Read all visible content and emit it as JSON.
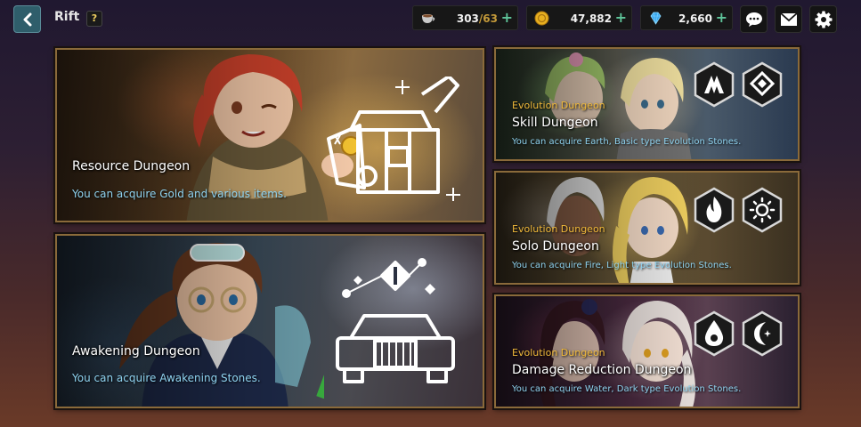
{
  "header": {
    "title": "Rift",
    "help_label": "?",
    "back_icon": "chevron-left-icon"
  },
  "resources": [
    {
      "icon": "coffee-cup-icon",
      "current": "303",
      "cap": "/63",
      "color": "#c49a3a"
    },
    {
      "icon": "gold-coin-icon",
      "value": "47,882",
      "color": "#e8b020"
    },
    {
      "icon": "diamond-icon",
      "value": "2,660",
      "color": "#3aa8f0"
    }
  ],
  "top_buttons": [
    "chat-icon",
    "mail-icon",
    "gear-icon"
  ],
  "dungeons": {
    "resource": {
      "name": "Resource Dungeon",
      "description": "You can acquire Gold and various items.",
      "icon": "treasure-chest-icon"
    },
    "awakening": {
      "name": "Awakening Dungeon",
      "description": "You can acquire Awakening Stones.",
      "icon": "vehicle-icon"
    },
    "skill": {
      "category": "Evolution Dungeon",
      "name": "Skill Dungeon",
      "description": "You can acquire Earth, Basic type Evolution Stones.",
      "elements": [
        "earth-element-icon",
        "basic-element-icon"
      ]
    },
    "solo": {
      "category": "Evolution Dungeon",
      "name": "Solo Dungeon",
      "description": "You can acquire Fire, Light type Evolution Stones.",
      "elements": [
        "fire-element-icon",
        "light-element-icon"
      ]
    },
    "damage_reduction": {
      "category": "Evolution Dungeon",
      "name": "Damage Reduction Dungeon",
      "description": "You can acquire Water, Dark type Evolution Stones.",
      "elements": [
        "water-element-icon",
        "dark-element-icon"
      ]
    }
  }
}
